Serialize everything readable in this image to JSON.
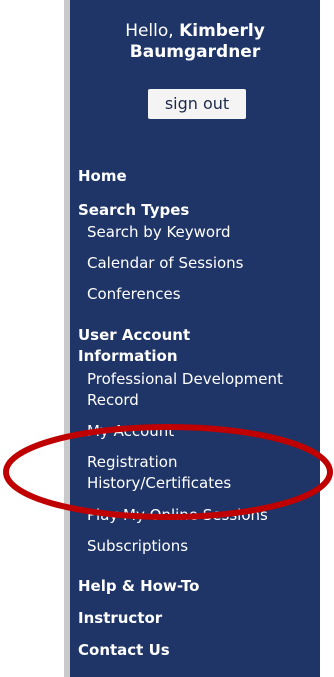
{
  "greeting": {
    "prefix": "Hello,",
    "first_name": "Kimberly",
    "last_name": "Baumgardner"
  },
  "signout_label": "sign out",
  "nav": {
    "home": "Home",
    "search_types": "Search Types",
    "search_by_keyword": "Search by Keyword",
    "calendar_of_sessions": "Calendar of Sessions",
    "conferences": "Conferences",
    "user_account_line1": "User Account",
    "user_account_line2": "Information",
    "pd_record_line1": "Professional Development",
    "pd_record_line2": "Record",
    "my_account": "My Account",
    "registration_line1": "Registration",
    "registration_line2": "History/Certificates",
    "play_online": "Play My Online Sessions",
    "subscriptions": "Subscriptions",
    "help": "Help & How-To",
    "instructor": "Instructor",
    "contact": "Contact Us"
  },
  "colors": {
    "sidebar_bg": "#1f3567",
    "highlight_ellipse": "#c00000"
  }
}
